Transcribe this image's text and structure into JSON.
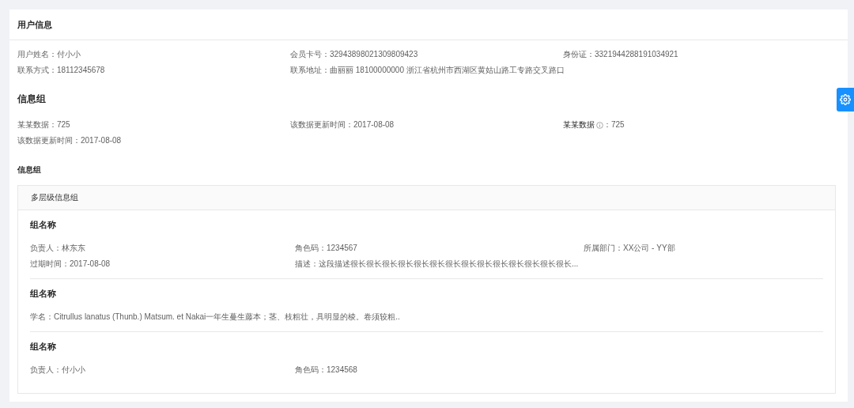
{
  "card": {
    "title": "用户信息"
  },
  "user_info": [
    "用户姓名：付小小",
    "会员卡号：32943898021309809423",
    "身份证：3321944288191034921",
    "联系方式：18112345678",
    "联系地址：曲丽丽 18100000000 浙江省杭州市西湖区黄姑山路工专路交叉路口"
  ],
  "info_group": {
    "title": "信息组",
    "items": [
      {
        "kind": "plain",
        "text": "某某数据：725"
      },
      {
        "kind": "plain",
        "text": "该数据更新时间：2017-08-08"
      },
      {
        "kind": "with-info",
        "label": "某某数据",
        "value": "：725"
      },
      {
        "kind": "plain",
        "text": "该数据更新时间：2017-08-08"
      }
    ]
  },
  "nested_section": {
    "title": "信息组",
    "box_title": "多层级信息组",
    "groups": [
      {
        "title": "组名称",
        "items": [
          "负责人：林东东",
          "角色码：1234567",
          "所属部门：XX公司 - YY部",
          "过期时间：2017-08-08",
          "描述：这段描述很长很长很长很长很长很长很长很长很长很长很长很长很长很长..."
        ]
      },
      {
        "title": "组名称",
        "items": [
          "学名：Citrullus lanatus (Thunb.) Matsum. et Nakai一年生蔓生藤本；茎、枝粗壮，具明显的棱。卷须较粗.."
        ]
      },
      {
        "title": "组名称",
        "items": [
          "负责人：付小小",
          "角色码：1234568"
        ]
      }
    ]
  }
}
